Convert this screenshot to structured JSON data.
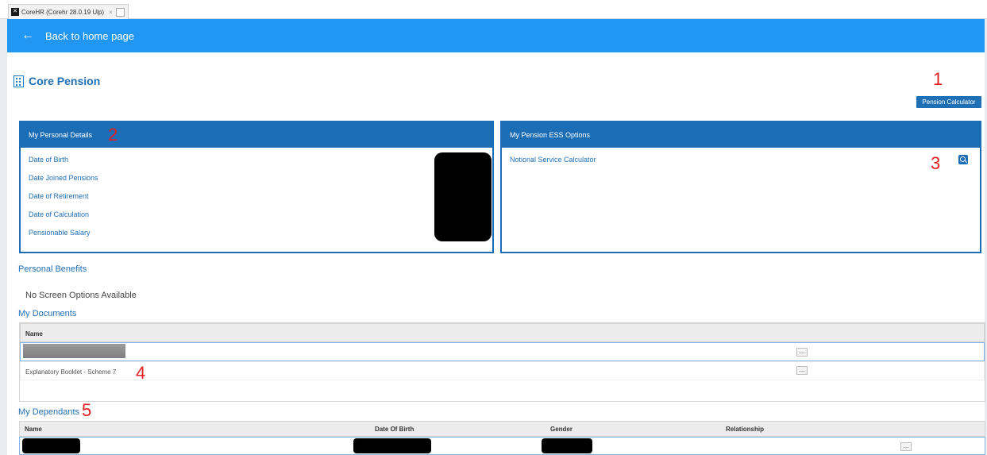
{
  "browser": {
    "tab_title": "CoreHR (Corehr 28.0.19 Ulp)",
    "tab_close": "×"
  },
  "topbar": {
    "back_icon": "←",
    "back_label": "Back to home page",
    "color": "#2196f3"
  },
  "page": {
    "title": "Core Pension",
    "title_icon": "building-icon",
    "calculator_button": "Pension Calculator"
  },
  "annotations": [
    "1",
    "2",
    "3",
    "4",
    "5"
  ],
  "personal_details": {
    "header": "My Personal Details",
    "items": [
      "Date of Birth",
      "Date Joined Pensions",
      "Date of Retirement",
      "Date of Calculation",
      "Pensionable Salary"
    ]
  },
  "ess_options": {
    "header": "My Pension ESS Options",
    "items": [
      "Notional Service Calculator"
    ]
  },
  "personal_benefits": {
    "title": "Personal Benefits",
    "message": "No Screen Options Available"
  },
  "documents": {
    "title": "My Documents",
    "column": "Name",
    "rows": [
      "",
      "Explanatory Booklet - Scheme 7"
    ],
    "more": "..."
  },
  "dependants": {
    "title": "My Dependants",
    "columns": [
      "Name",
      "Date Of Birth",
      "Gender",
      "Relationship"
    ],
    "more": "..."
  }
}
